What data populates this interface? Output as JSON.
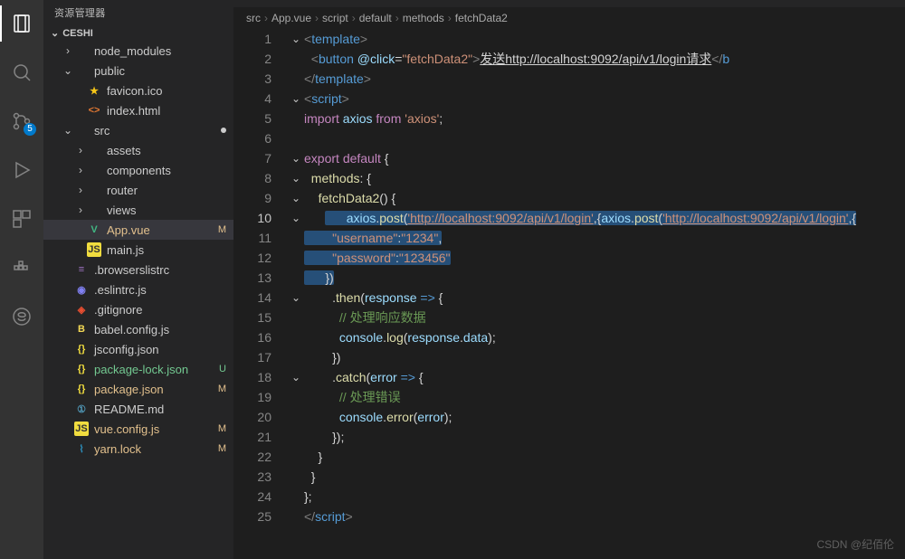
{
  "activity": {
    "scm_badge": "5"
  },
  "sidebar": {
    "title": "资源管理器",
    "root": "CESHI",
    "items": [
      {
        "kind": "folder",
        "label": "node_modules",
        "depth": 1,
        "expand": "closed"
      },
      {
        "kind": "folder",
        "label": "public",
        "depth": 1,
        "expand": "open"
      },
      {
        "kind": "file",
        "label": "favicon.ico",
        "depth": 2,
        "icon": "star"
      },
      {
        "kind": "file",
        "label": "index.html",
        "depth": 2,
        "icon": "html"
      },
      {
        "kind": "folder",
        "label": "src",
        "depth": 1,
        "expand": "open",
        "dirty": true
      },
      {
        "kind": "folder",
        "label": "assets",
        "depth": 2,
        "expand": "closed"
      },
      {
        "kind": "folder",
        "label": "components",
        "depth": 2,
        "expand": "closed"
      },
      {
        "kind": "folder",
        "label": "router",
        "depth": 2,
        "expand": "closed"
      },
      {
        "kind": "folder",
        "label": "views",
        "depth": 2,
        "expand": "closed"
      },
      {
        "kind": "file",
        "label": "App.vue",
        "depth": 2,
        "icon": "vue",
        "status": "M",
        "mod": true,
        "active": true
      },
      {
        "kind": "file",
        "label": "main.js",
        "depth": 2,
        "icon": "js"
      },
      {
        "kind": "file",
        "label": ".browserslistrc",
        "depth": 1,
        "icon": "brows"
      },
      {
        "kind": "file",
        "label": ".eslintrc.js",
        "depth": 1,
        "icon": "eslint"
      },
      {
        "kind": "file",
        "label": ".gitignore",
        "depth": 1,
        "icon": "git"
      },
      {
        "kind": "file",
        "label": "babel.config.js",
        "depth": 1,
        "icon": "babel"
      },
      {
        "kind": "file",
        "label": "jsconfig.json",
        "depth": 1,
        "icon": "json"
      },
      {
        "kind": "file",
        "label": "package-lock.json",
        "depth": 1,
        "icon": "json",
        "status": "U",
        "unt": true
      },
      {
        "kind": "file",
        "label": "package.json",
        "depth": 1,
        "icon": "json",
        "status": "M",
        "mod": true
      },
      {
        "kind": "file",
        "label": "README.md",
        "depth": 1,
        "icon": "md"
      },
      {
        "kind": "file",
        "label": "vue.config.js",
        "depth": 1,
        "icon": "js",
        "status": "M",
        "mod": true
      },
      {
        "kind": "file",
        "label": "yarn.lock",
        "depth": 1,
        "icon": "yarn",
        "status": "M",
        "mod": true
      }
    ]
  },
  "breadcrumbs": [
    "src",
    "App.vue",
    "script",
    "default",
    "methods",
    "fetchData2"
  ],
  "code": {
    "lines": [
      {
        "n": 1,
        "fold": "v",
        "seg": [
          [
            "tag",
            "<"
          ],
          [
            "el",
            "template"
          ],
          [
            "tag",
            ">"
          ]
        ]
      },
      {
        "n": 2,
        "seg": [
          [
            "txt",
            "  "
          ],
          [
            "tag",
            "<"
          ],
          [
            "el",
            "button"
          ],
          [
            "txt",
            " "
          ],
          [
            "attr",
            "@click"
          ],
          [
            "txt",
            "="
          ],
          [
            "str",
            "\"fetchData2\""
          ],
          [
            "tag",
            ">"
          ],
          [
            "btn",
            "发送http://localhost:9092/api/v1/login请求"
          ],
          [
            "tag",
            "</"
          ],
          [
            "el",
            "b"
          ]
        ]
      },
      {
        "n": 3,
        "seg": [
          [
            "tag",
            "</"
          ],
          [
            "el",
            "template"
          ],
          [
            "tag",
            ">"
          ]
        ]
      },
      {
        "n": 4,
        "fold": "v",
        "seg": [
          [
            "tag",
            "<"
          ],
          [
            "el",
            "script"
          ],
          [
            "tag",
            ">"
          ]
        ]
      },
      {
        "n": 5,
        "seg": [
          [
            "kw",
            "import"
          ],
          [
            "txt",
            " "
          ],
          [
            "var",
            "axios"
          ],
          [
            "txt",
            " "
          ],
          [
            "kw",
            "from"
          ],
          [
            "txt",
            " "
          ],
          [
            "str",
            "'axios'"
          ],
          [
            "txt",
            ";"
          ]
        ]
      },
      {
        "n": 6,
        "seg": []
      },
      {
        "n": 7,
        "fold": "v",
        "seg": [
          [
            "kw",
            "export"
          ],
          [
            "txt",
            " "
          ],
          [
            "kw",
            "default"
          ],
          [
            "txt",
            " {"
          ]
        ]
      },
      {
        "n": 8,
        "fold": "v",
        "seg": [
          [
            "txt",
            "  "
          ],
          [
            "fn",
            "methods"
          ],
          [
            "txt",
            ": {"
          ]
        ]
      },
      {
        "n": 9,
        "fold": "v",
        "seg": [
          [
            "txt",
            "    "
          ],
          [
            "fn",
            "fetchData2"
          ],
          [
            "txt",
            "() {"
          ]
        ]
      },
      {
        "n": 10,
        "cur": true,
        "fold": "v",
        "bulb": true,
        "selStart": true,
        "seg": [
          [
            "txt",
            "      "
          ],
          [
            "var",
            "axios"
          ],
          [
            "txt",
            "."
          ],
          [
            "fn",
            "post"
          ],
          [
            "txt",
            "("
          ],
          [
            "link",
            "'http://localhost:9092/api/v1/login'"
          ],
          [
            "txt",
            ",{"
          ]
        ]
      },
      {
        "n": 11,
        "sel": true,
        "seg": [
          [
            "txt",
            "        "
          ],
          [
            "str",
            "\"username\""
          ],
          [
            "txt",
            ":"
          ],
          [
            "str",
            "\"1234\""
          ],
          [
            "txt",
            ","
          ]
        ]
      },
      {
        "n": 12,
        "sel": true,
        "seg": [
          [
            "txt",
            "        "
          ],
          [
            "str",
            "\"password\""
          ],
          [
            "txt",
            ":"
          ],
          [
            "str",
            "\"123456\""
          ]
        ]
      },
      {
        "n": 13,
        "selEnd": true,
        "seg": [
          [
            "txt",
            "      })"
          ]
        ]
      },
      {
        "n": 14,
        "fold": "v",
        "seg": [
          [
            "txt",
            "        ."
          ],
          [
            "fn",
            "then"
          ],
          [
            "txt",
            "("
          ],
          [
            "var",
            "response"
          ],
          [
            "txt",
            " "
          ],
          [
            "kw2",
            "=>"
          ],
          [
            "txt",
            " {"
          ]
        ]
      },
      {
        "n": 15,
        "seg": [
          [
            "txt",
            "          "
          ],
          [
            "cmt",
            "// 处理响应数据"
          ]
        ]
      },
      {
        "n": 16,
        "seg": [
          [
            "txt",
            "          "
          ],
          [
            "var",
            "console"
          ],
          [
            "txt",
            "."
          ],
          [
            "fn",
            "log"
          ],
          [
            "txt",
            "("
          ],
          [
            "var",
            "response"
          ],
          [
            "txt",
            "."
          ],
          [
            "var",
            "data"
          ],
          [
            "txt",
            ");"
          ]
        ]
      },
      {
        "n": 17,
        "seg": [
          [
            "txt",
            "        })"
          ]
        ]
      },
      {
        "n": 18,
        "fold": "v",
        "seg": [
          [
            "txt",
            "        ."
          ],
          [
            "fn",
            "catch"
          ],
          [
            "txt",
            "("
          ],
          [
            "var",
            "error"
          ],
          [
            "txt",
            " "
          ],
          [
            "kw2",
            "=>"
          ],
          [
            "txt",
            " {"
          ]
        ]
      },
      {
        "n": 19,
        "seg": [
          [
            "txt",
            "          "
          ],
          [
            "cmt",
            "// 处理错误"
          ]
        ]
      },
      {
        "n": 20,
        "seg": [
          [
            "txt",
            "          "
          ],
          [
            "var",
            "console"
          ],
          [
            "txt",
            "."
          ],
          [
            "fn",
            "error"
          ],
          [
            "txt",
            "("
          ],
          [
            "var",
            "error"
          ],
          [
            "txt",
            ");"
          ]
        ]
      },
      {
        "n": 21,
        "seg": [
          [
            "txt",
            "        });"
          ]
        ]
      },
      {
        "n": 22,
        "seg": [
          [
            "txt",
            "    }"
          ]
        ]
      },
      {
        "n": 23,
        "seg": [
          [
            "txt",
            "  }"
          ]
        ]
      },
      {
        "n": 24,
        "seg": [
          [
            "txt",
            "};"
          ]
        ]
      },
      {
        "n": 25,
        "seg": [
          [
            "tag",
            "</"
          ],
          [
            "el",
            "script"
          ],
          [
            "tag",
            ">"
          ]
        ]
      }
    ]
  },
  "watermark": "CSDN @纪佰伦"
}
